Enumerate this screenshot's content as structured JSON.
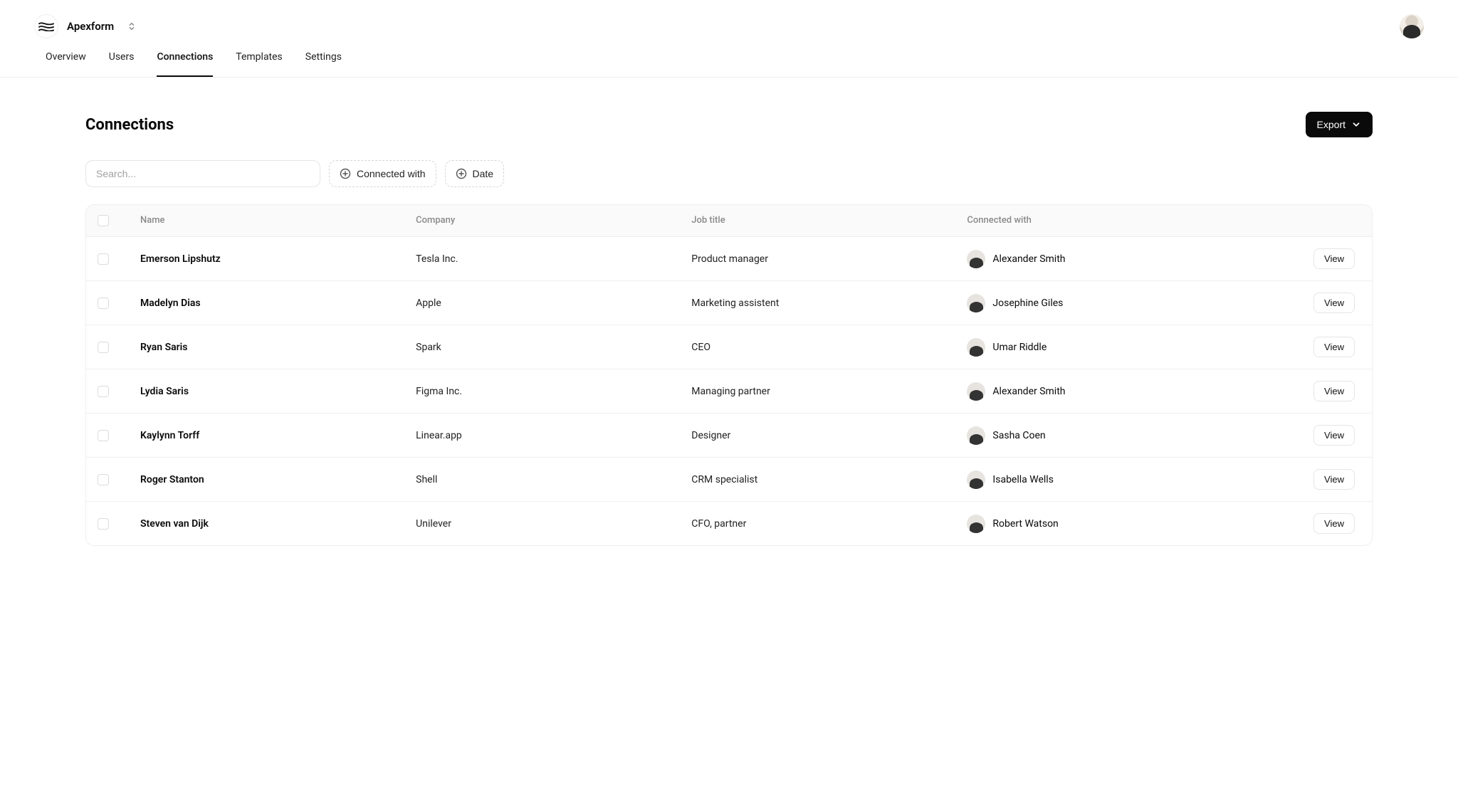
{
  "brand": {
    "name": "Apexform"
  },
  "nav": {
    "items": [
      {
        "label": "Overview",
        "active": false
      },
      {
        "label": "Users",
        "active": false
      },
      {
        "label": "Connections",
        "active": true
      },
      {
        "label": "Templates",
        "active": false
      },
      {
        "label": "Settings",
        "active": false
      }
    ]
  },
  "page": {
    "title": "Connections"
  },
  "actions": {
    "export_label": "Export"
  },
  "filters": {
    "search_placeholder": "Search...",
    "connected_with_label": "Connected with",
    "date_label": "Date"
  },
  "table": {
    "columns": {
      "name": "Name",
      "company": "Company",
      "job": "Job title",
      "connected": "Connected with"
    },
    "view_label": "View",
    "rows": [
      {
        "name": "Emerson Lipshutz",
        "company": "Tesla Inc.",
        "job": "Product manager",
        "connected": "Alexander Smith"
      },
      {
        "name": "Madelyn Dias",
        "company": "Apple",
        "job": "Marketing assistent",
        "connected": "Josephine Giles"
      },
      {
        "name": "Ryan Saris",
        "company": "Spark",
        "job": "CEO",
        "connected": "Umar Riddle"
      },
      {
        "name": "Lydia Saris",
        "company": "Figma Inc.",
        "job": "Managing partner",
        "connected": "Alexander Smith"
      },
      {
        "name": "Kaylynn Torff",
        "company": "Linear.app",
        "job": "Designer",
        "connected": "Sasha Coen"
      },
      {
        "name": "Roger Stanton",
        "company": "Shell",
        "job": "CRM specialist",
        "connected": "Isabella Wells"
      },
      {
        "name": "Steven van Dijk",
        "company": "Unilever",
        "job": "CFO, partner",
        "connected": "Robert Watson"
      }
    ]
  }
}
